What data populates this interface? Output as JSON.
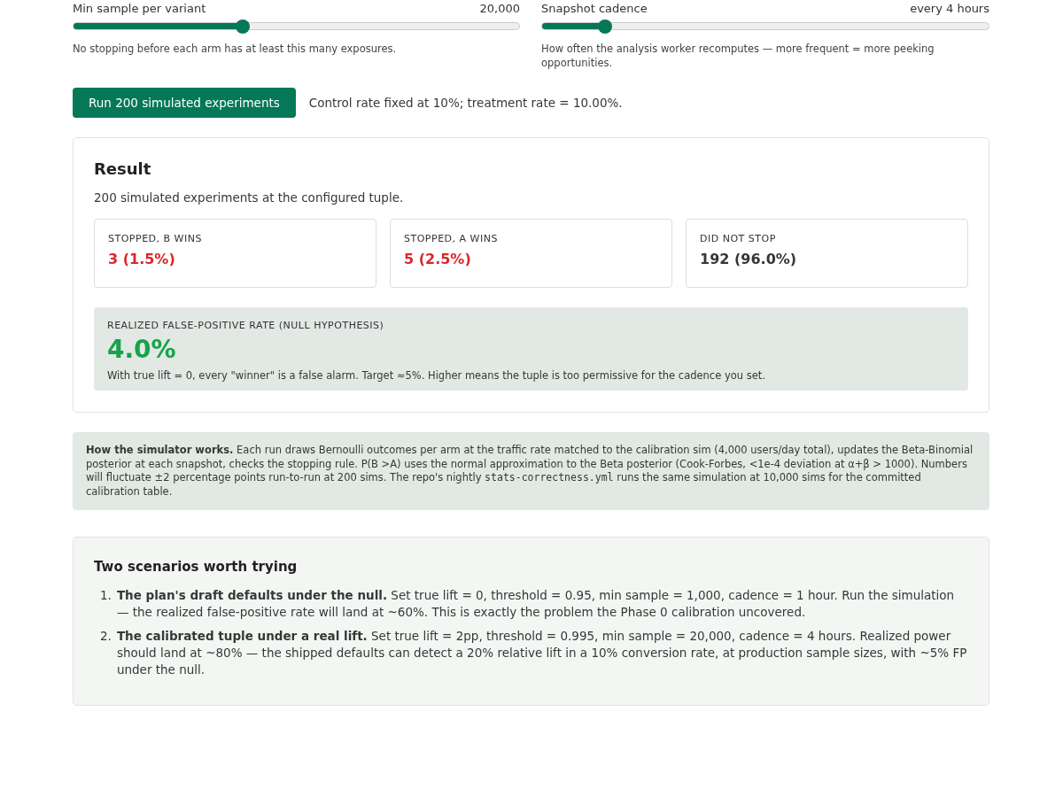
{
  "sliders": [
    {
      "label": "Min sample per variant",
      "value": "20,000",
      "level": 0.38,
      "help": "No stopping before each arm has at least this many exposures."
    },
    {
      "label": "Snapshot cadence",
      "value": "every 4 hours",
      "level": 0.14,
      "help": "How often the analysis worker recomputes — more frequent = more peeking opportunities."
    }
  ],
  "run_button": "Run 200 simulated experiments",
  "run_note": "Control rate fixed at 10%; treatment rate = 10.00%.",
  "result": {
    "title": "Result",
    "subtitle": "200 simulated experiments at the configured tuple.",
    "stats": [
      {
        "label": "STOPPED, B WINS",
        "value": "3 (1.5%)",
        "kind": "alert"
      },
      {
        "label": "STOPPED, A WINS",
        "value": "5 (2.5%)",
        "kind": "alert"
      },
      {
        "label": "DID NOT STOP",
        "value": "192 (96.0%)",
        "kind": "neutral"
      }
    ],
    "fp": {
      "label": "REALIZED FALSE-POSITIVE RATE (NULL HYPOTHESIS)",
      "value": "4.0%",
      "note": "With true lift = 0, every \"winner\" is a false alarm. Target ≈5%. Higher means the tuple is too permissive for the cadence you set."
    }
  },
  "how": {
    "lead": "How the simulator works.",
    "text": " Each run draws Bernoulli outcomes per arm at the traffic rate matched to the calibration sim (4,000 users/day total), updates the Beta-Binomial posterior at each snapshot, checks the stopping rule. P(B >A) uses the normal approximation to the Beta posterior (Cook-Forbes, <1e-4 deviation at α+β > 1000). Numbers will fluctuate ±2 percentage points run-to-run at 200 sims. The repo's nightly ",
    "code": "stats-correctness.yml",
    "tail": " runs the same simulation at 10,000 sims for the committed calibration table."
  },
  "scenarios": {
    "title": "Two scenarios worth trying",
    "items": [
      {
        "number": "1.",
        "text": "**The plan's draft defaults under the null.** Set true lift = 0, threshold = 0.95, min sample = 1,000, cadence = 1 hour. Run the simulation — the realized false-positive rate will land at ~60%. This is exactly the problem the Phase 0 calibration uncovered."
      },
      {
        "number": "2.",
        "text": "**The calibrated tuple under a real lift.** Set true lift = 2pp, threshold = 0.995, min sample = 20,000, cadence = 4 hours. Realized power should land at ~80% — the shipped defaults can detect a 20% relative lift in a 10% conversion rate, at production sample sizes, with ~5% FP under the null."
      }
    ]
  }
}
